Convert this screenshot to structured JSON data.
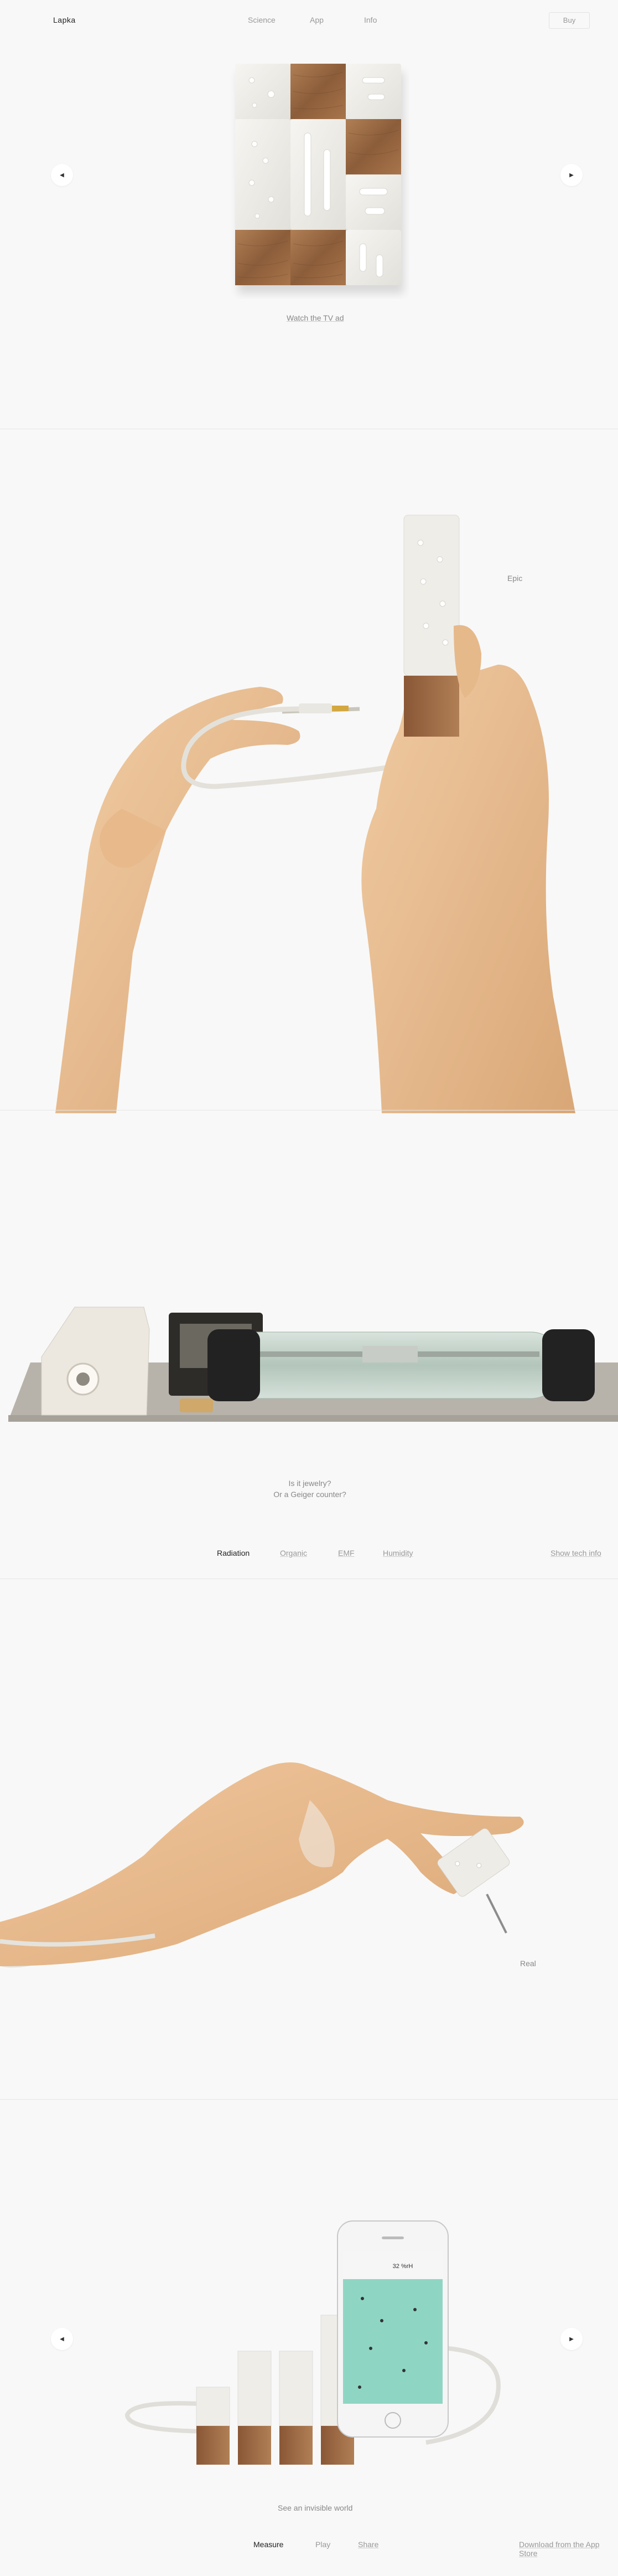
{
  "header": {
    "logo": "Lapka",
    "nav": [
      "Science",
      "App",
      "Info"
    ],
    "buy_label": "Buy"
  },
  "hero": {
    "watch_link": "Watch the TV ad"
  },
  "section_epic": {
    "label": "Epic"
  },
  "section_geiger": {
    "line1": "Is it jewelry?",
    "line2": "Or a Geiger counter?"
  },
  "sensor_tabs": {
    "items": [
      "Radiation",
      "Organic",
      "EMF",
      "Humidity"
    ],
    "active": "Radiation",
    "tech_link": "Show tech info"
  },
  "section_real": {
    "label": "Real"
  },
  "section_app": {
    "caption": "See an invisible world",
    "phone_reading": "32 %rH",
    "tabs": [
      "Measure",
      "Play",
      "Share"
    ],
    "active_tab": "Measure",
    "app_store_link": "Download from the App Store"
  },
  "colors": {
    "background": "#f8f8f8",
    "text_dark": "#222222",
    "text_muted": "#999999",
    "wood": "#9b6b45",
    "ceramic": "#ecebe6",
    "skin": "#e6b98b",
    "screen": "#8fd5c4"
  }
}
